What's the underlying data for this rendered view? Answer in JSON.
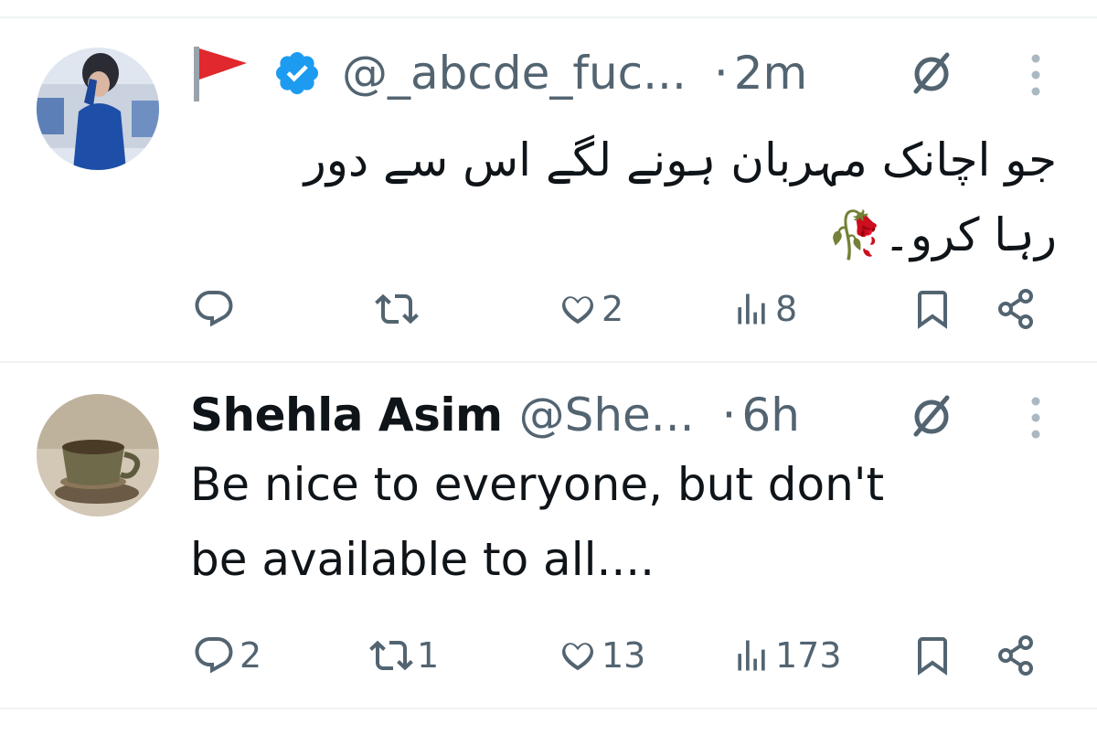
{
  "tweets": [
    {
      "flag_emoji": "🚩",
      "display_name": "",
      "handle": "@_abcde_fuc...",
      "separator": "·",
      "time": "2m",
      "text_lines": [
        "جو اچانک مہربان ہونے لگے اس سے دور",
        "رہا کرو۔🥀"
      ],
      "stats": {
        "replies": "",
        "retweets": "",
        "likes": "2",
        "views": "8"
      },
      "verified": true
    },
    {
      "display_name": "Shehla Asim",
      "handle": "@She...",
      "separator": "·",
      "time": "6h",
      "text_lines": [
        "Be nice to everyone, but don't",
        "be available to all...."
      ],
      "stats": {
        "replies": "2",
        "retweets": "1",
        "likes": "13",
        "views": "173"
      }
    }
  ],
  "colors": {
    "text": "#0f1419",
    "secondary": "#536471",
    "verified": "#1d9bf0",
    "divider": "#eff3f4"
  },
  "icons": [
    "reply-icon",
    "retweet-icon",
    "like-icon",
    "views-icon",
    "bookmark-icon",
    "share-icon",
    "mute-icon",
    "more-icon",
    "verified-icon"
  ]
}
